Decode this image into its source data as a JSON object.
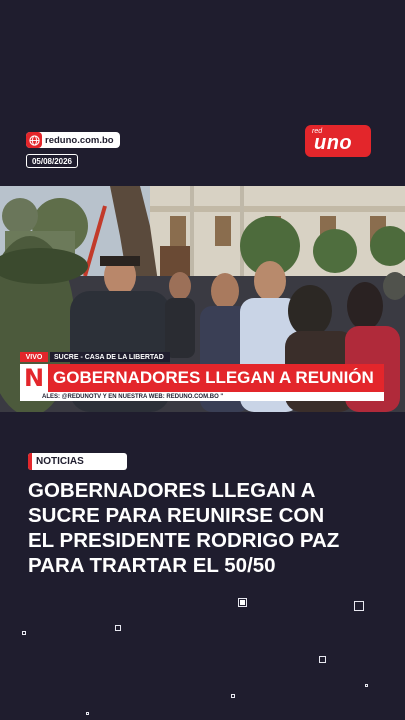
{
  "header": {
    "site_url": "reduno.com.bo",
    "date": "05/08/2026",
    "logo_small": "red",
    "logo_main": "uno",
    "brand_color": "#e3262b"
  },
  "broadcast": {
    "live_tag": "VIVO",
    "location": "SUCRE - CASA DE LA LIBERTAD",
    "channel_letter": "N",
    "headline": "GOBERNADORES LLEGAN A REUNIÓN",
    "ticker": "ALES: @REDUNOTV Y EN NUESTRA WEB: REDUNO.COM.BO \""
  },
  "article": {
    "section": "NOTICIAS",
    "title_lines": [
      "GOBERNADORES LLEGAN A",
      "SUCRE PARA REUNIRSE CON",
      "EL PRESIDENTE RODRIGO PAZ",
      "PARA TRARTAR EL 50/50"
    ]
  },
  "colors": {
    "background": "#1f1d2e",
    "accent": "#e3262b",
    "text": "#ffffff"
  }
}
